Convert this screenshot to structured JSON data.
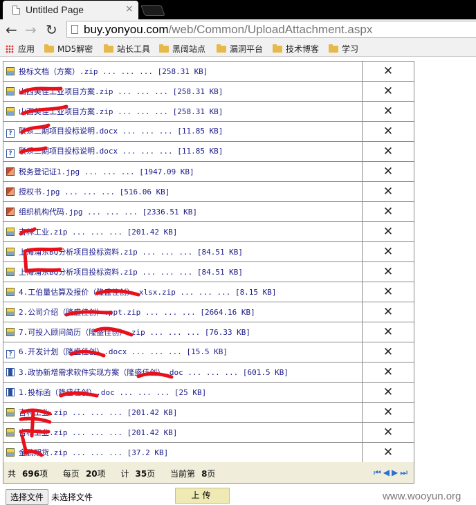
{
  "browser": {
    "tab_title": "Untitled Page",
    "tab_close": "×",
    "url_host": "buy.yonyou.com",
    "url_path": "/web/Common/UploadAttachment.aspx",
    "back": "←",
    "forward": "→",
    "reload": "↻",
    "bookmarks": [
      "应用",
      "MD5解密",
      "站长工具",
      "黑阔站点",
      "漏洞平台",
      "技术博客",
      "学习"
    ]
  },
  "files": [
    {
      "icon": "zip",
      "text": "投标文档（方案）.zip ... ... ... [258.31 KB]"
    },
    {
      "icon": "zip",
      "text": "山西美佳工业项目方案.zip ... ... ... [258.31 KB]"
    },
    {
      "icon": "zip",
      "text": "山西美佳工业项目方案.zip ... ... ... [258.31 KB]"
    },
    {
      "icon": "docx",
      "text": "联系二期项目投标说明.docx ... ... ... [11.85 KB]"
    },
    {
      "icon": "docx",
      "text": "联系二期项目投标说明.docx ... ... ... [11.85 KB]"
    },
    {
      "icon": "jpg",
      "text": "税务登记证1.jpg ... ... ... [1947.09 KB]"
    },
    {
      "icon": "jpg",
      "text": "授权书.jpg ... ... ... [516.06 KB]"
    },
    {
      "icon": "jpg",
      "text": "组织机构代码.jpg ... ... ... [2336.51 KB]"
    },
    {
      "icon": "zip",
      "text": "吉林工业.zip ... ... ... [201.42 KB]"
    },
    {
      "icon": "zip",
      "text": "上海浦东BQ分析项目投标资料.zip ... ... ... [84.51 KB]"
    },
    {
      "icon": "zip",
      "text": "上海浦东BQ分析项目投标资料.zip ... ... ... [84.51 KB]"
    },
    {
      "icon": "zip",
      "text": "4.工伯量估算及报价（隆盛佳创）.xlsx.zip ... ... ... [8.15 KB]"
    },
    {
      "icon": "zip",
      "text": "2.公司介绍（隆盛佳创）.ppt.zip ... ... ... [2664.16 KB]"
    },
    {
      "icon": "zip",
      "text": "7.可投入顾问简历（隆盛佳创）.zip ... ... ... [76.33 KB]"
    },
    {
      "icon": "docx",
      "text": "6.开发计划（隆盛佳创）.docx ... ... ... [15.5 KB]"
    },
    {
      "icon": "doc",
      "text": "3.政协新增需求软件实现方案（隆盛佳创）.doc ... ... ... [601.5 KB]"
    },
    {
      "icon": "doc",
      "text": "1.投标函（隆盛佳创）.doc ... ... ... [25 KB]"
    },
    {
      "icon": "zip",
      "text": "吉林工业.zip ... ... ... [201.42 KB]"
    },
    {
      "icon": "zip",
      "text": "吉林工业.zip ... ... ... [201.42 KB]"
    },
    {
      "icon": "zip",
      "text": "金鹏期货.zip ... ... ... [37.2 KB]"
    }
  ],
  "delete_symbol": "✕",
  "pager": {
    "total_prefix": "共",
    "total": "696",
    "total_suffix": "项",
    "per_page_prefix": "每页",
    "per_page": "20",
    "per_page_suffix": "项",
    "pages_prefix": "计",
    "pages": "35",
    "pages_suffix": "页",
    "current_prefix": "当前第",
    "current": "8",
    "current_suffix": "页",
    "nav": "⏮◀▶⏭"
  },
  "upload": {
    "choose_label": "选择文件",
    "no_file": "未选择文件",
    "button": "上传"
  },
  "watermark": "www.wooyun.org"
}
